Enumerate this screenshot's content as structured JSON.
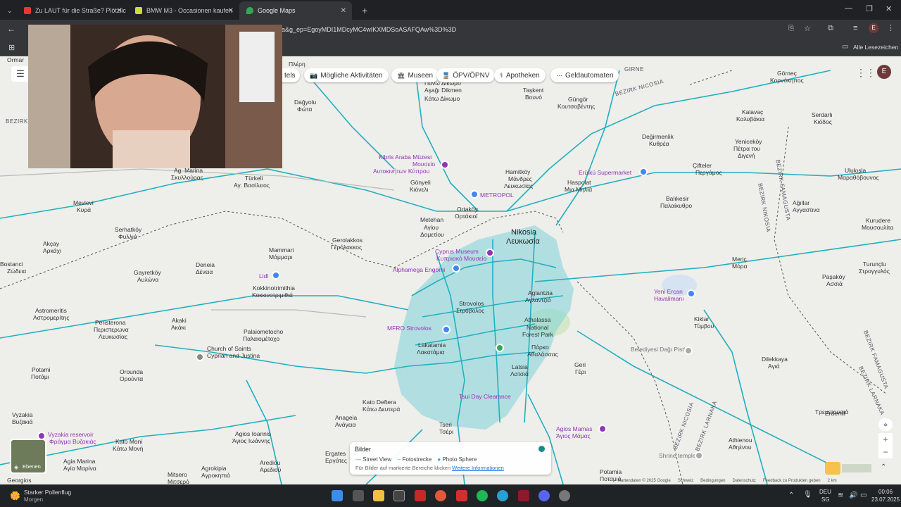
{
  "tabs": [
    {
      "title": "Zu LAUT für die Straße? Plötzlic",
      "color": "#e53935"
    },
    {
      "title": "BMW M3 - Occasionen kaufen",
      "color": "#cddc39"
    },
    {
      "title": "Google Maps",
      "color": "#34a853"
    }
  ],
  "url": "a&g_ep=EgoyMDI1MDcyMC4wIKXMDSoASAFQAw%3D%3D",
  "bookmarks_label": "Alle Lesezeichen",
  "profile_letter": "E",
  "chips": [
    {
      "icon": "activity-icon",
      "label": "Mögliche Aktivitäten"
    },
    {
      "icon": "museum-icon",
      "label": "Museen"
    },
    {
      "icon": "transit-icon",
      "label": "ÖPV/ÖPNV"
    },
    {
      "icon": "pharmacy-icon",
      "label": "Apotheken"
    },
    {
      "icon": "atm-icon",
      "label": "Geldautomaten"
    }
  ],
  "chip_partial": "tels",
  "map_labels": [
    "Ormar",
    "BEZIRK",
    "Dağyolu",
    "Φώτα",
    "Πλέρη",
    "Πάνω Δίκωμο",
    "Aşağı Dikmen",
    "Κάτω Δίκωμο",
    "Taşkent",
    "Βουνό",
    "Güngör",
    "Κουτσοβέντης",
    "GIRNE",
    "BEZIRK NICOSIA",
    "Görneç",
    "Κορνόκηπος",
    "Kalavaç",
    "Καλυβάκια",
    "Serdarlı",
    "Κιόδος",
    "Değirmenlik",
    "Κυθρέα",
    "Yeniceköy",
    "Πέτρα του",
    "Διγενή",
    "Çifteler",
    "Περγάμος",
    "BEZIRK NIKOSIA",
    "BEZIRK FAMAGUSTA",
    "Ulukışla",
    "Μαραθόβουνος",
    "Kurudere",
    "Μουσουλίτα",
    "Ağıllar",
    "Αγγαστινα",
    "Hamitköy",
    "Μάνδρες",
    "Λευκωσίας",
    "Haspolat",
    "Μια Μηλιά",
    "Kibris Araba Müzesi",
    "Μουσείο",
    "Αυτοκινήτων Κύπρου",
    "Gönyeli",
    "Κιόνελι",
    "Ortaköy",
    "Ορτάκιοϊ",
    "Metehan",
    "Αγίου",
    "Δομετίου",
    "Nikosia",
    "Λευκωσία",
    "Balıkesir",
    "Παλαίκυθρο",
    "Ag. Marina",
    "Σκυλλούρας",
    "Türkeli",
    "Αγ. Βασίλειος",
    "Mevievi",
    "Κυρά",
    "Serhatköy",
    "Φυλλιά",
    "Akçay",
    "Αρκάχι",
    "Gerolakkos",
    "Γερόλακκος",
    "Mammari",
    "Μάμμαρι",
    "Deneia",
    "Δένεια",
    "Cyprus Museum",
    "Κυπριακό Μουσείο",
    "Alphamega Engomi",
    "Meriç",
    "Μόρα",
    "Yeni Ercan",
    "Havalimanı",
    "Turunçlu",
    "Στρογγυλός",
    "Paşaköy",
    "Ασσιά",
    "Bostanci",
    "Ζώδεια",
    "Gayretköy",
    "Αυλώνα",
    "Kokkinotrimithia",
    "Κοκκινοτριμιθιά",
    "Lidl",
    "Aglantzia",
    "Αγλαντζιά",
    "Strovolos",
    "Στρόβολος",
    "Astromeritis",
    "Αστρομερίτης",
    "Akaki",
    "Ακάκι",
    "Peristerona",
    "Περιστερωνα",
    "Λευκωσίας",
    "Palaiometocho",
    "Παλαιομέτοχο",
    "Athalassa",
    "National",
    "Forest Park",
    "Πάρκο",
    "Αθαλάσσας",
    "Kiklar",
    "Τύμβου",
    "BEZIRK FAMAGUSTA",
    "Lakatamia",
    "Λακατάμια",
    "Church of Saints",
    "Cyprian and Justina",
    "MFRO Strovolos",
    "Latsia",
    "Λατσιά",
    "Geri",
    "Γέρι",
    "Dilekkaya",
    "Αγιά",
    "Potami",
    "Ποτάμι",
    "Orounda",
    "Ορούντα",
    "Kato Deftera",
    "Κάτω Δευτερά",
    "Agios Ioannis",
    "Άγιος Ιωάννης",
    "Anageia",
    "Ανάγεια",
    "Ergates",
    "Εργάτες",
    "Vyzakia",
    "Βυζακιά",
    "Vyzakia reservoir",
    "Φράγμα Βυζακιάς",
    "Kato Moni",
    "Κάτω Μονή",
    "Agia Marina",
    "Αγία Μαρίνα",
    "Agrokipia",
    "Αγροκηπιά",
    "Mitsero",
    "Μιτσερό",
    "Arediou",
    "Αρεδιού",
    "Tseri",
    "Τσέρι",
    "Agios Mamas",
    "Άγιος Μάμας",
    "Potamia",
    "Ποταμιά",
    "Erdemli",
    "Τρεμετουσιά",
    "Athienou",
    "Αθηένου",
    "BEZIRK NICOSIA",
    "BEZIRK LARNAKA",
    "BEZIRK LARNAKA",
    "Georgios",
    "Erülkü Supermarket",
    "METROPOL",
    "Belediyesi Dağı Pisti",
    "Shrine temple",
    "Tsui Day Clearance"
  ],
  "bilder": {
    "title": "Bilder",
    "legend_street": "Street View",
    "legend_foto": "Fotostrecke",
    "legend_sphere": "Photo Sphere",
    "hint": "Für Bilder auf markierte Bereiche klicken",
    "link": "Weitere Informationen"
  },
  "layers_label": "Ebenen",
  "attribution": [
    "Kartendaten © 2025 Google",
    "Schweiz",
    "Bedingungen",
    "Datenschutz",
    "Feedback zu Produkten geben",
    "2 km"
  ],
  "taskbar": {
    "weather_title": "Starker Pollenflug",
    "weather_sub": "Morgen",
    "lang": "DEU",
    "lang_sub": "SG",
    "time": "00:06",
    "date": "23.07.2025"
  }
}
